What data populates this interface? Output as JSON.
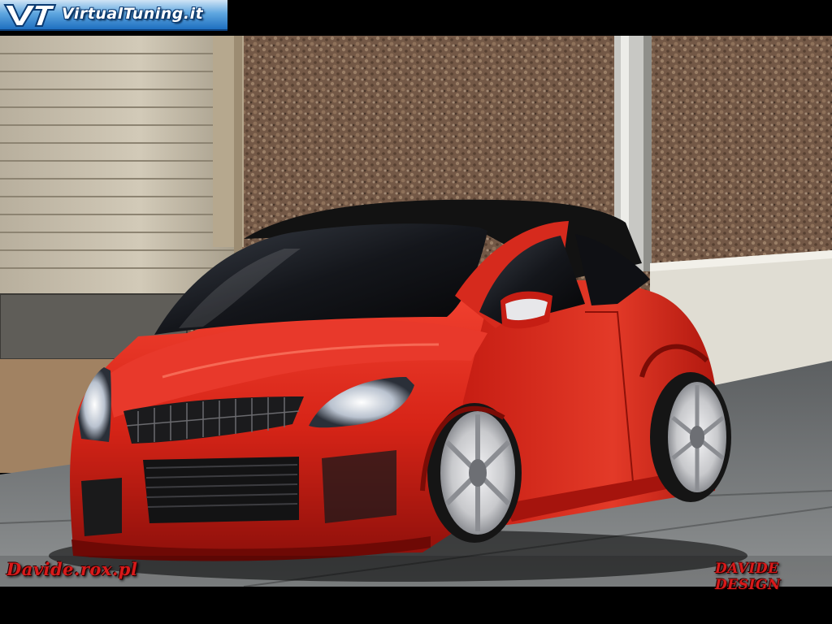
{
  "watermark": {
    "logo_text": "VirtualTuning.it",
    "signature_left": "Davide.rox.pl",
    "signature_right": "DAVIDE DESIGN"
  },
  "scene": {
    "subject": "red-hatchback-car",
    "colors": {
      "car_body": "#d9261c",
      "roof": "#111111",
      "wall": "#8a6c56",
      "garage_door": "#cfc7b4",
      "ground": "#7d7f80",
      "logo_blue": "#1e6fc0"
    }
  }
}
